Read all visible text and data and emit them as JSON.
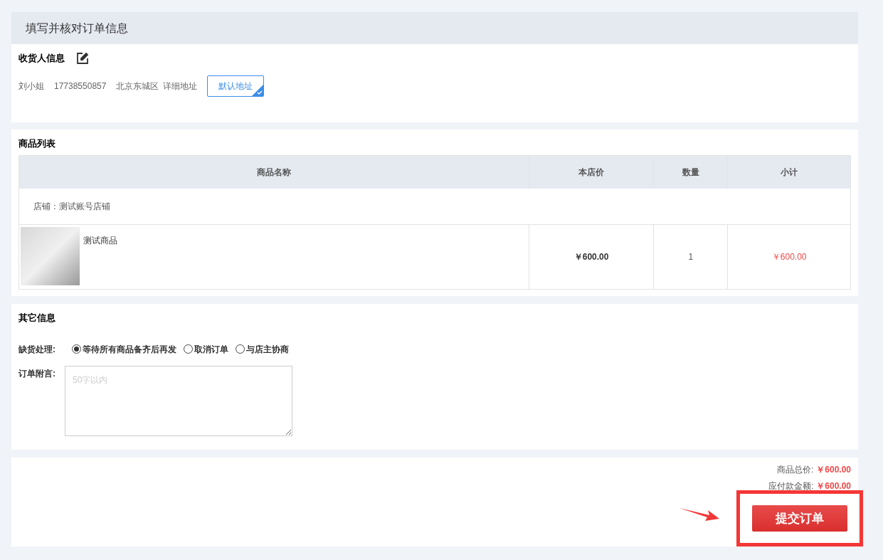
{
  "page_title": "填写并核对订单信息",
  "receiver": {
    "title": "收货人信息",
    "name": "刘小姐",
    "phone": "17738550857",
    "region": "北京东城区",
    "address": "详细地址",
    "default_tag": {
      "label": "默认地址",
      "selected": true
    }
  },
  "goods": {
    "title": "商品列表",
    "columns": [
      "商品名称",
      "本店价",
      "数量",
      "小计"
    ],
    "shop": "店铺：测试账号店铺",
    "rows": [
      {
        "name": "测试商品",
        "price": "￥600.00",
        "quantity": "1",
        "subtotal": "￥600.00"
      }
    ]
  },
  "other": {
    "title": "其它信息",
    "stockout_label": "缺货处理:",
    "options": [
      {
        "label": "等待所有商品备齐后再发",
        "selected": true
      },
      {
        "label": "取消订单",
        "selected": false
      },
      {
        "label": "与店主协商",
        "selected": false
      }
    ],
    "note_label": "订单附言:",
    "note_placeholder": "50字以内"
  },
  "summary": {
    "lines": [
      {
        "label": "商品总价:",
        "value": "￥600.00"
      },
      {
        "label": "应付款金额:",
        "value": "￥600.00"
      }
    ],
    "submit": "提交订单"
  }
}
